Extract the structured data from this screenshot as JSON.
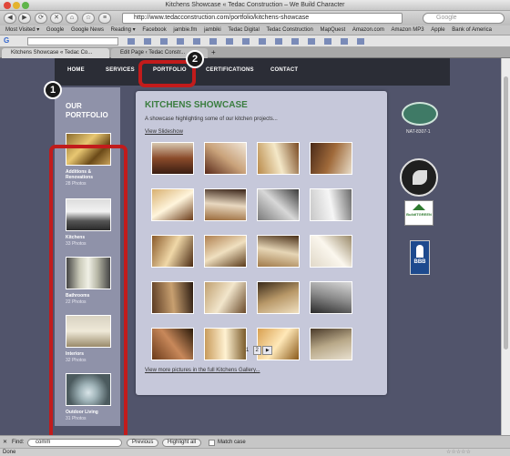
{
  "window": {
    "title": "Kitchens Showcase « Tedac Construction – We Build Character"
  },
  "toolbar": {
    "url": "http://www.tedacconstruction.com/portfolio/kitchens-showcase",
    "search_placeholder": "Google"
  },
  "bookmarks": [
    "Most Visited ▾",
    "Google",
    "Google News",
    "Reading ▾",
    "Facebook",
    "jambie.fm",
    "jambiki",
    "Tedac Digital",
    "Tedac Construction",
    "MapQuest",
    "Amazon.com",
    "Amazon MP3",
    "Apple",
    "Bank of America"
  ],
  "tabs": [
    {
      "label": "Kitchens Showcase « Tedac Co..."
    },
    {
      "label": "Edit Page ‹ Tedac Constr..."
    }
  ],
  "nav": {
    "items": [
      "HOME",
      "SERVICES",
      "PORTFOLIO",
      "CERTIFICATIONS",
      "CONTACT"
    ]
  },
  "sidebar": {
    "title_line1": "OUR",
    "title_line2": "PORTFOLIO",
    "items": [
      {
        "label_line1": "Additions &",
        "label_line2": "Renovations",
        "count": "28 Photos"
      },
      {
        "label_line1": "Kitchens",
        "label_line2": "",
        "count": "33 Photos"
      },
      {
        "label_line1": "Bathrooms",
        "label_line2": "",
        "count": "22 Photos"
      },
      {
        "label_line1": "Interiors",
        "label_line2": "",
        "count": "32 Photos"
      },
      {
        "label_line1": "Outdoor Living",
        "label_line2": "",
        "count": "31 Photos"
      }
    ]
  },
  "content": {
    "title": "KITCHENS SHOWCASE",
    "description": "A showcase highlighting some of our kitchen projects...",
    "slideshow_link": "View Slideshow",
    "pager": {
      "page1": "1",
      "page2": "2",
      "next": "▶"
    },
    "more_link": "View more pictures in the full Kitchens Gallery..."
  },
  "badges": {
    "lead_code": "NAT-8307-1",
    "buildgreen": "BuildITGREEN",
    "bbb": "BBB"
  },
  "callouts": {
    "one": "1",
    "two": "2"
  },
  "findbar": {
    "label": "Find:",
    "value": "comm",
    "previous": "Previous",
    "highlight": "Highlight all",
    "match_case": "Match case"
  },
  "status": {
    "text": "Done"
  }
}
